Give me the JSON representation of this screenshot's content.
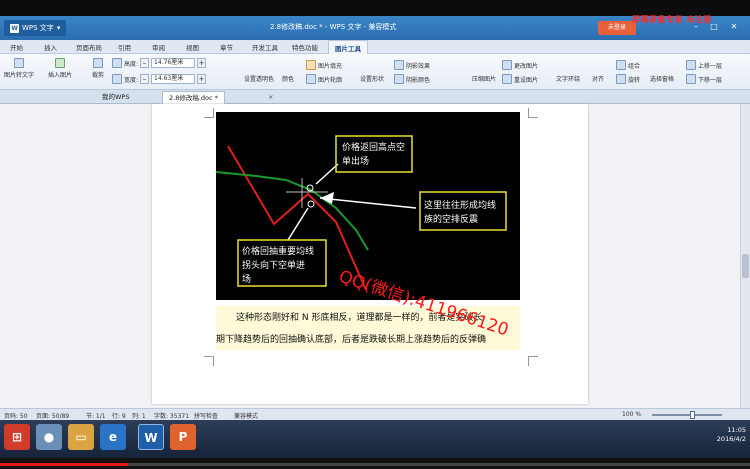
{
  "window": {
    "app_button": "WPS 文字",
    "title": "2.8修改稿.doc * - WPS 文字 - 兼容模式",
    "login": "未登录",
    "overlay_text": "屏幕录像专家 未注册"
  },
  "menu_tabs": [
    "开始",
    "插入",
    "页面布局",
    "引用",
    "审阅",
    "视图",
    "章节",
    "开发工具",
    "特色功能",
    "图片工具"
  ],
  "active_tab": "图片工具",
  "ribbon": {
    "picture_to_text": "图片转文字",
    "insert_picture": "插入图片",
    "crop": "裁剪",
    "height_label": "高度:",
    "height_value": "14.76厘米",
    "width_label": "宽度:",
    "width_value": "14.63厘米",
    "set_transparent": "设置透明色",
    "color": "颜色",
    "picture_outline": "图片轮廓",
    "picture_fill": "图片填充",
    "set_shape": "设置形状",
    "shadow_effect": "阴影效果",
    "shadow_color": "阴影颜色",
    "compress": "压缩图片",
    "change_picture": "更改图片",
    "reset_picture": "重设图片",
    "text_wrap": "文字环绕",
    "align": "对齐",
    "combine": "组合",
    "rotate": "旋转",
    "select_pane": "选择窗格",
    "bring_forward": "上移一层",
    "send_backward": "下移一层"
  },
  "doc_tabs": [
    "我的WPS",
    "2.8修改稿.doc *"
  ],
  "chart": {
    "box_top": [
      "价格返回高点空",
      "单出场"
    ],
    "box_right": [
      "这里往往形成均线",
      "族的空排反震"
    ],
    "box_left": [
      "价格回抽重要均线",
      "拐头向下空单进",
      "场"
    ]
  },
  "watermark": "QQ(微信):411966120",
  "document": {
    "line1": "这种形态刚好和 N 形底相反，道理都是一样的，前者是突破长",
    "line2": "期下降趋势后的回抽确认底部，后者是跌破长期上涨趋势后的反弹确"
  },
  "status": {
    "page": "页码: 50",
    "pages": "页面: 50/89",
    "section": "节: 1/1",
    "row": "行: 9",
    "col": "列: 1",
    "words": "字数: 35371",
    "spell": "拼写检查",
    "compat": "兼容模式",
    "zoom": "100 %"
  },
  "taskbar": {
    "time": "11:05",
    "date": "2016/4/2"
  },
  "colors": {
    "title_bar": "#2a6eb0",
    "price_line": "#e02020",
    "ma_line": "#1a9a2a",
    "annotation_box": "#e8e030",
    "watermark": "#ff1a1a"
  },
  "video_progress": 0.17
}
